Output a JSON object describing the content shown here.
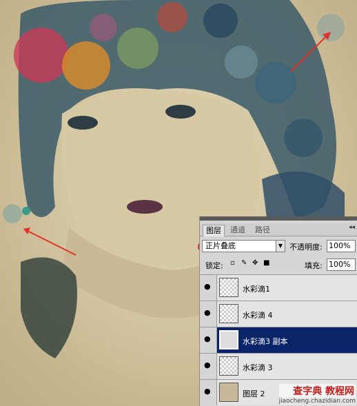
{
  "panel": {
    "tabs": [
      "图层",
      "通道",
      "路径"
    ],
    "collapse_glyph": "◂◂",
    "blend_mode": "正片叠底",
    "opacity_label": "不透明度:",
    "opacity_value": "100%",
    "lock_label": "锁定:",
    "fill_label": "填充:",
    "fill_value": "100%",
    "layers": [
      {
        "name": "水彩滴1",
        "selected": false
      },
      {
        "name": "水彩滴 4",
        "selected": false
      },
      {
        "name": "水彩滴3 副本",
        "selected": true
      },
      {
        "name": "水彩滴 3",
        "selected": false
      },
      {
        "name": "图层 2",
        "selected": false
      }
    ]
  },
  "watermark": {
    "brand": "查字典 教程网",
    "url": "jiaocheng.chazidian.com"
  },
  "colors": {
    "selection": "#0a246a",
    "annotation_red": "#e0332a",
    "paper": "#d9cba8"
  }
}
